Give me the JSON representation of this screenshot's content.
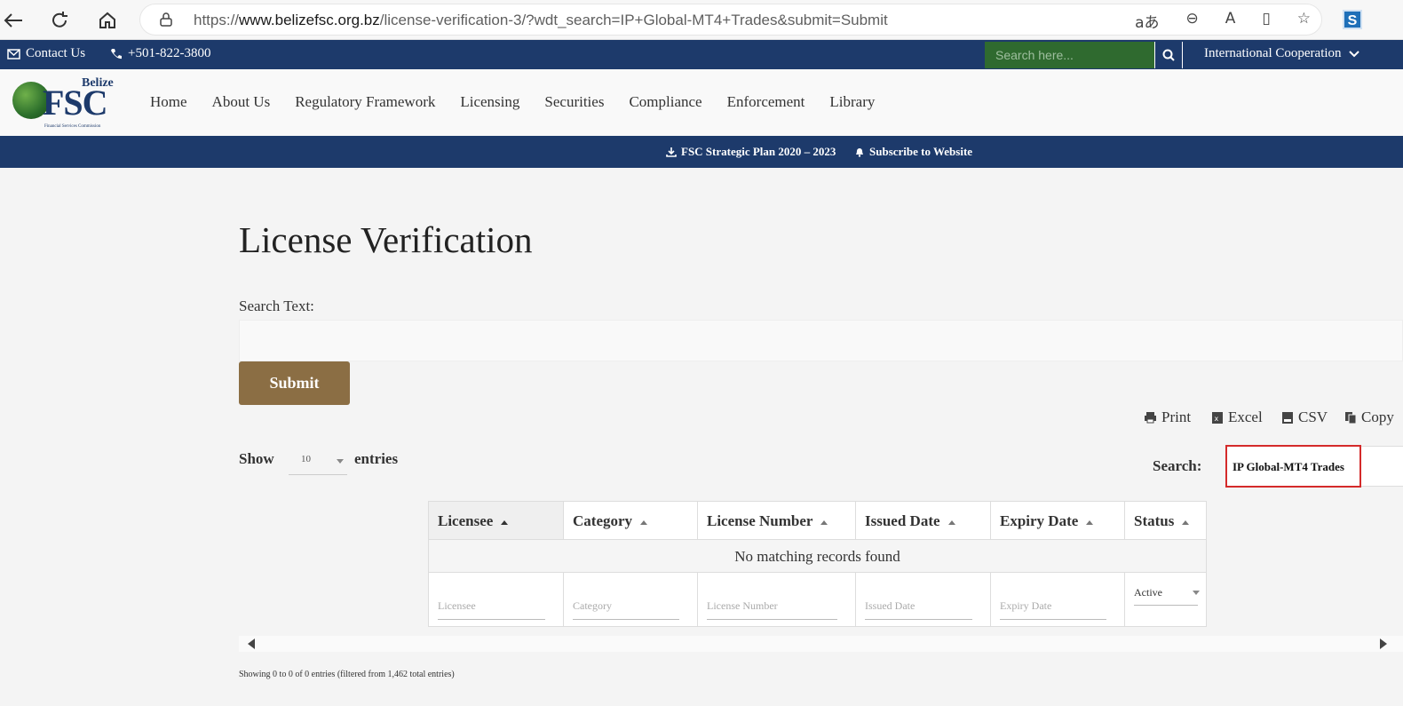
{
  "browser": {
    "url_prefix": "https://",
    "url_domain": "www.belizefsc.org.bz",
    "url_path": "/license-verification-3/?wdt_search=IP+Global-MT4+Trades&submit=Submit",
    "ext_letter": "S"
  },
  "topbar": {
    "contact": "Contact Us",
    "phone": "+501-822-3800",
    "search_placeholder": "Search here...",
    "intl": "International Cooperation"
  },
  "logo": {
    "top": "Belize",
    "main": "FSC",
    "sub": "Financial Services Commission"
  },
  "nav": [
    "Home",
    "About Us",
    "Regulatory Framework",
    "Licensing",
    "Securities",
    "Compliance",
    "Enforcement",
    "Library"
  ],
  "bluebar": {
    "plan": "FSC Strategic Plan 2020 – 2023",
    "subscribe": "Subscribe to Website"
  },
  "page": {
    "title": "License Verification",
    "search_label": "Search Text:",
    "submit": "Submit"
  },
  "export": {
    "print": "Print",
    "excel": "Excel",
    "csv": "CSV",
    "copy": "Copy"
  },
  "table_controls": {
    "show": "Show",
    "entries_value": "10",
    "entries": "entries",
    "search_label": "Search:",
    "search_value": "IP Global-MT4 Trades"
  },
  "table": {
    "headers": [
      "Licensee",
      "Category",
      "License Number",
      "Issued Date",
      "Expiry Date",
      "Status"
    ],
    "empty": "No matching records found",
    "filters": [
      "Licensee",
      "Category",
      "License Number",
      "Issued Date",
      "Expiry Date"
    ],
    "status_filter": "Active"
  },
  "info": "Showing 0 to 0 of 0 entries (filtered from 1,462 total entries)",
  "colors": {
    "navy": "#1d3a6b",
    "submit": "#8b6e44",
    "search_green": "#2f6a2f",
    "highlight_red": "#d42a2a"
  }
}
